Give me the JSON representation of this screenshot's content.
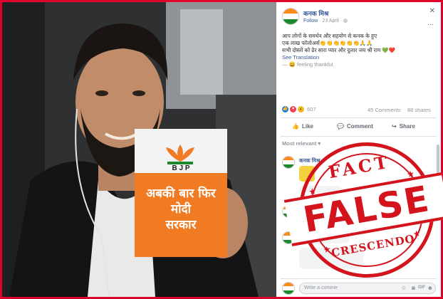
{
  "post": {
    "author": "कनक मिश्र",
    "follow_label": "Follow",
    "date": "· 23 April · ",
    "text_line1": "आप लोगों के समर्थन और सहयोग से कनक के हुए",
    "text_line2": "एक लाख फॉलोअर्स👏👏👏👏👏👏🙏🙏",
    "text_line3": "सभी दोस्तों को ढेर सारा प्यार और दुलार जय श्री राम 💚❤️",
    "see_translation": "See Translation",
    "feeling": "— 😀 feeling thankful.",
    "reaction_count": "607",
    "comments_count": "45 Comments",
    "shares_count": "88 shares",
    "like_label": "Like",
    "comment_label": "Comment",
    "share_label": "Share",
    "sort_label": "Most relevant ▾",
    "comment_author": "कनक मिश्र",
    "comment_placeholder": "Write a comme"
  },
  "photo": {
    "booklet_brand": "B J P",
    "booklet_line1": "अबकी बार फिर",
    "booklet_line2": "मोदी",
    "booklet_line3": "सरकार"
  },
  "stamp": {
    "top_text": "FACT",
    "main_text": "FALSE",
    "bottom_text": "CRESCENDO"
  },
  "colors": {
    "frame": "#e0002a",
    "stamp": "#d3141c",
    "link": "#385898",
    "booklet_orange": "#f07b22"
  }
}
